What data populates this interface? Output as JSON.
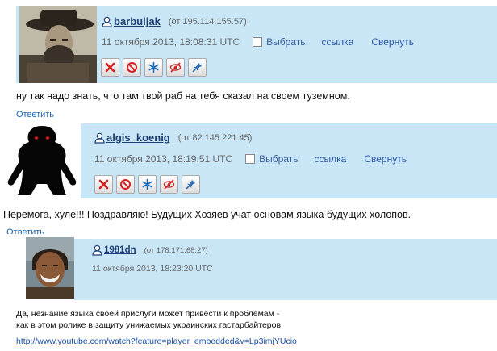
{
  "comments": [
    {
      "username": "barbuljak",
      "ip": "(от 195.114.155.57)",
      "date": "11 октября 2013, 18:08:31 UTC",
      "select_label": "Выбрать",
      "link_label": "ссылка",
      "collapse_label": "Свернуть",
      "text": "ну так надо знать, что там твой раб на тебя сказал на своем туземном.",
      "reply_label": "Ответить"
    },
    {
      "username": "algis_koenig",
      "ip": "(от 82.145.221.45)",
      "date": "11 октября 2013, 18:19:51 UTC",
      "select_label": "Выбрать",
      "link_label": "ссылка",
      "collapse_label": "Свернуть",
      "text": "Перемога, хуле!!! Поздравляю! Будущих Хозяев учат основам языка будущих холопов.",
      "reply_label": "Ответить"
    },
    {
      "username": "1981dn",
      "ip": "(от 178.171.68.27)",
      "date": "11 октября 2013, 18:23:20 UTC",
      "text_line1": "Да, незнание языка своей прислуги может привести к проблемам -",
      "text_line2": "как в этом ролике в защиту унижаемых украинских гастарбайтеров:",
      "link": "http://www.youtube.com/watch?feature=player_embedded&v=Lp3imjYUcio"
    }
  ],
  "colors": {
    "header_band": "#c9e6f7",
    "username": "#1e3f73",
    "link": "#2b58a6"
  }
}
